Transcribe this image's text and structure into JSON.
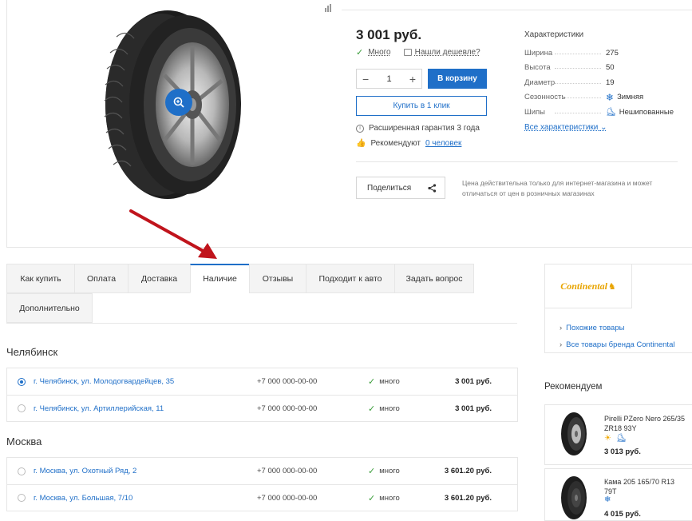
{
  "product": {
    "price": "3 001 руб.",
    "stock_label": "Много",
    "cheaper_label": "Нашли дешевле?",
    "qty": "1",
    "cart_label": "В корзину",
    "oneclick_label": "Купить в 1 клик",
    "warranty_label": "Расширенная гарантия 3 года",
    "recommend_prefix": "Рекомендуют",
    "recommend_link": "0 человек",
    "share_label": "Поделиться",
    "price_note": "Цена действительна только для интернет-магазина и может отличаться от цен в розничных магазинах"
  },
  "specs": {
    "title": "Характеристики",
    "rows": [
      {
        "name": "Ширина",
        "value": "275"
      },
      {
        "name": "Высота",
        "value": "50"
      },
      {
        "name": "Диаметр",
        "value": "19"
      },
      {
        "name": "Сезонность",
        "value": "Зимняя",
        "icon": "snowflake-icon"
      },
      {
        "name": "Шипы",
        "value": "Нешипованные",
        "icon": "no-studs-icon"
      }
    ],
    "all_label": "Все характеристики"
  },
  "tabs": [
    {
      "label": "Как купить"
    },
    {
      "label": "Оплата"
    },
    {
      "label": "Доставка"
    },
    {
      "label": "Наличие",
      "active": true
    },
    {
      "label": "Отзывы"
    },
    {
      "label": "Подходит к авто"
    },
    {
      "label": "Задать вопрос"
    },
    {
      "label": "Дополнительно"
    }
  ],
  "cities": [
    {
      "name": "Челябинск",
      "stores": [
        {
          "address": "г. Челябинск, ул. Молодогвардейцев, 35",
          "phone": "+7 000 000-00-00",
          "stock": "много",
          "price": "3 001 руб.",
          "selected": true
        },
        {
          "address": "г. Челябинск, ул. Артиллерийская, 11",
          "phone": "+7 000 000-00-00",
          "stock": "много",
          "price": "3 001 руб.",
          "selected": false
        }
      ]
    },
    {
      "name": "Москва",
      "stores": [
        {
          "address": "г. Москва, ул. Охотный Ряд, 2",
          "phone": "+7 000 000-00-00",
          "stock": "много",
          "price": "3 601.20 руб.",
          "selected": false
        },
        {
          "address": "г. Москва, ул. Большая, 7/10",
          "phone": "+7 000 000-00-00",
          "stock": "много",
          "price": "3 601.20 руб.",
          "selected": false
        }
      ]
    }
  ],
  "brand": {
    "logo_text": "Continental",
    "links": [
      "Похожие товары",
      "Все товары бренда Continental"
    ]
  },
  "recommend": {
    "title": "Рекомендуем",
    "items": [
      {
        "name": "Pirelli PZero Nero 265/35 ZR18 93Y",
        "price": "3 013 руб.",
        "icons": [
          "sun-icon",
          "no-studs-icon"
        ]
      },
      {
        "name": "Кама 205 165/70 R13 79T",
        "price": "4 015 руб.",
        "icons": [
          "snowflake-icon"
        ]
      }
    ]
  },
  "colors": {
    "accent": "#1f6fc8",
    "stock_green": "#3a9d3a",
    "arrow_red": "#c0141c",
    "brand_orange": "#e8a400"
  }
}
